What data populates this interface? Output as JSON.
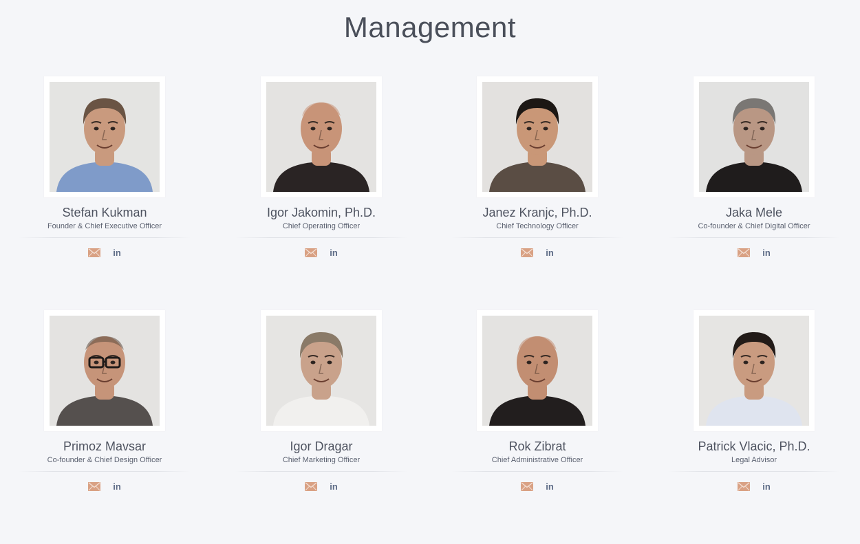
{
  "page": {
    "title": "Management"
  },
  "icons": {
    "mail": "mail-icon",
    "linkedin": "linkedin-icon"
  },
  "colors": {
    "background": "#f5f6f9",
    "mail_icon": "#d9a184",
    "linkedin_icon": "#5d6b86"
  },
  "team": [
    {
      "name": "Stefan Kukman",
      "role": "Founder & Chief Executive Officer",
      "linkedin_label": "in",
      "photo": {
        "skin": "#c99a7e",
        "hair": "#6a5444",
        "shirt": "#7f9bc9",
        "bg": "#e4e4e2",
        "bald": false,
        "glasses": false
      }
    },
    {
      "name": "Igor Jakomin, Ph.D.",
      "role": "Chief Operating Officer",
      "linkedin_label": "in",
      "photo": {
        "skin": "#c89478",
        "hair": "#c89478",
        "shirt": "#2a2424",
        "bg": "#e4e3e1",
        "bald": true,
        "glasses": false
      }
    },
    {
      "name": "Janez Kranjc, Ph.D.",
      "role": "Chief Technology Officer",
      "linkedin_label": "in",
      "photo": {
        "skin": "#c99777",
        "hair": "#1c1714",
        "shirt": "#5a4d44",
        "bg": "#e3e1df",
        "bald": false,
        "glasses": false
      }
    },
    {
      "name": "Jaka Mele",
      "role": "Co-founder & Chief Digital Officer",
      "linkedin_label": "in",
      "photo": {
        "skin": "#b99784",
        "hair": "#7a7774",
        "shirt": "#1f1c1c",
        "bg": "#e2e2e1",
        "bald": false,
        "glasses": false
      }
    },
    {
      "name": "Primoz Mavsar",
      "role": "Co-founder & Chief Design Officer",
      "linkedin_label": "in",
      "photo": {
        "skin": "#c69479",
        "hair": "#5c4a3e",
        "shirt": "#55504e",
        "bg": "#e4e3e1",
        "bald": true,
        "glasses": true
      }
    },
    {
      "name": "Igor Dragar",
      "role": "Chief Marketing Officer",
      "linkedin_label": "in",
      "photo": {
        "skin": "#c9a28b",
        "hair": "#8a7a68",
        "shirt": "#f1f0ee",
        "bg": "#e6e5e3",
        "bald": false,
        "glasses": false
      }
    },
    {
      "name": "Rok Zibrat",
      "role": "Chief Administrative Officer",
      "linkedin_label": "in",
      "photo": {
        "skin": "#c28e72",
        "hair": "#c28e72",
        "shirt": "#221e1e",
        "bg": "#e4e3e1",
        "bald": true,
        "glasses": false
      }
    },
    {
      "name": "Patrick Vlacic, Ph.D.",
      "role": "Legal Advisor",
      "linkedin_label": "in",
      "photo": {
        "skin": "#c99b80",
        "hair": "#221b18",
        "shirt": "#dfe4ef",
        "bg": "#e6e5e3",
        "bald": false,
        "glasses": false
      }
    }
  ]
}
